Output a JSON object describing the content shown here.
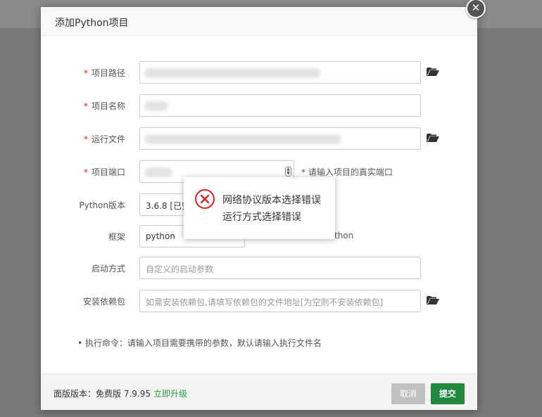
{
  "dialog": {
    "title": "添加Python项目",
    "close_label": "✕"
  },
  "form": {
    "required_mark": "*",
    "project_path": {
      "label": "项目路径",
      "value": ""
    },
    "project_name": {
      "label": "项目名称",
      "value": ""
    },
    "run_file": {
      "label": "运行文件",
      "value": ""
    },
    "project_port": {
      "label": "项目端口",
      "value": "",
      "hint": "* 请输入项目的真实端口"
    },
    "python_version": {
      "label": "Python版本",
      "value": "3.6.8 [已安"
    },
    "framework": {
      "label": "框架",
      "value": "python",
      "hint_suffix": "thon"
    },
    "startup_mode": {
      "label": "启动方式",
      "placeholder": "自定义的启动参数"
    },
    "dependencies": {
      "label": "安装依赖包",
      "placeholder": "如需安装依赖包,请填写依赖包的文件地址[为空则不安装依赖包]"
    }
  },
  "note": "•  执行命令：请输入项目需要携带的参数，默认请输入执行文件名",
  "footer": {
    "version_text": "面版版本：免费版 7.9.95",
    "upgrade_label": "立即升级",
    "cancel_label": "取消",
    "submit_label": "提交"
  },
  "toast": {
    "icon": "error-circle-icon",
    "line1": "网络协议版本选择错误",
    "line2": "运行方式选择错误",
    "color": "#e02020"
  },
  "icons": {
    "folder": "folder-open-icon"
  }
}
